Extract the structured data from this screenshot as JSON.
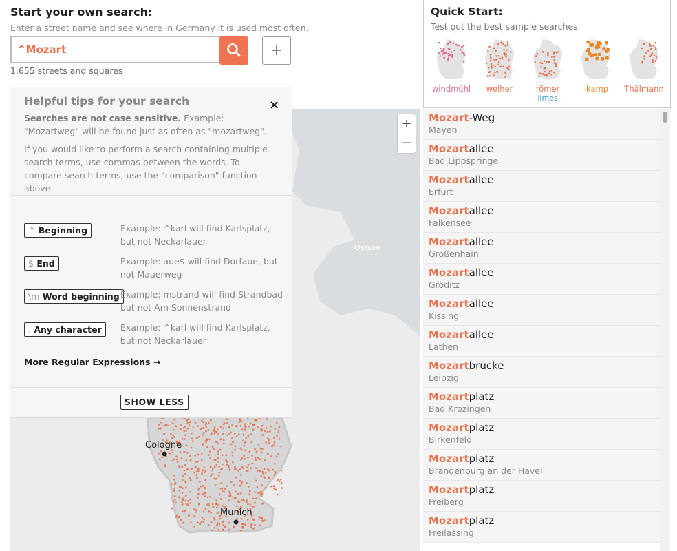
{
  "search": {
    "title": "Start your own search:",
    "subtitle": "Enter a street name and see where in Germany it is used most often.",
    "value": "^Mozart",
    "count": "1,655 streets and squares"
  },
  "quick": {
    "title": "Quick Start:",
    "subtitle": "Test out the best sample searches",
    "items": [
      {
        "label": "windmühl",
        "color": "#e06a9a"
      },
      {
        "label": "weiher",
        "color": "#e8734f"
      },
      {
        "label": "römer",
        "sublabel": "limes",
        "color": "#e8734f"
      },
      {
        "label": "-kamp",
        "color": "#e8882a"
      },
      {
        "label": "Thälmann",
        "color": "#e8734f"
      }
    ]
  },
  "tips": {
    "title": "Helpful tips for your search",
    "close": "×",
    "p1_bold": "Searches are not case sensitive.",
    "p1_rest": " Example: \"Mozartweg\" will be found just as often as \"mozartweg\".",
    "p2": "If you would like to perform a search containing multiple search terms, use commas between the words. To compare search terms, use the \"comparison\" function above.",
    "regex": [
      {
        "sym": "^",
        "label": "Beginning",
        "example": "Example: ^karl will find Karlsplatz, but not Neckarlauer"
      },
      {
        "sym": "$",
        "label": "End",
        "example": "Example: aue$ will find Dorfaue, but not Mauerweg"
      },
      {
        "sym": "\\m",
        "label": "Word beginning",
        "example": "Example: mstrand will find Strandbad but not Am Sonnenstrand"
      },
      {
        "sym": ".",
        "label": "Any character",
        "example": "Example: ^karl will find Karlsplatz, but not Neckarlauer"
      }
    ],
    "more": "More Regular Expressions →",
    "show_less": "SHOW LESS"
  },
  "map": {
    "cities": [
      "Cologne",
      "Munich"
    ],
    "sea": "Ostsee",
    "zoom_in": "+",
    "zoom_out": "−",
    "dot_color": "#e8734f"
  },
  "results": [
    {
      "hl": "Mozart",
      "rest": "-Weg",
      "city": "Mayen"
    },
    {
      "hl": "Mozart",
      "rest": "allee",
      "city": "Bad Lippspringe"
    },
    {
      "hl": "Mozart",
      "rest": "allee",
      "city": "Erfurt"
    },
    {
      "hl": "Mozart",
      "rest": "allee",
      "city": "Falkensee"
    },
    {
      "hl": "Mozart",
      "rest": "allee",
      "city": "Großenhain"
    },
    {
      "hl": "Mozart",
      "rest": "allee",
      "city": "Gröditz"
    },
    {
      "hl": "Mozart",
      "rest": "allee",
      "city": "Kissing"
    },
    {
      "hl": "Mozart",
      "rest": "allee",
      "city": "Lathen"
    },
    {
      "hl": "Mozart",
      "rest": "brücke",
      "city": "Leipzig"
    },
    {
      "hl": "Mozart",
      "rest": "platz",
      "city": "Bad Krozingen"
    },
    {
      "hl": "Mozart",
      "rest": "platz",
      "city": "Birkenfeld"
    },
    {
      "hl": "Mozart",
      "rest": "platz",
      "city": "Brandenburg an der Havel"
    },
    {
      "hl": "Mozart",
      "rest": "platz",
      "city": "Freiberg"
    },
    {
      "hl": "Mozart",
      "rest": "platz",
      "city": "Freilassing"
    }
  ]
}
